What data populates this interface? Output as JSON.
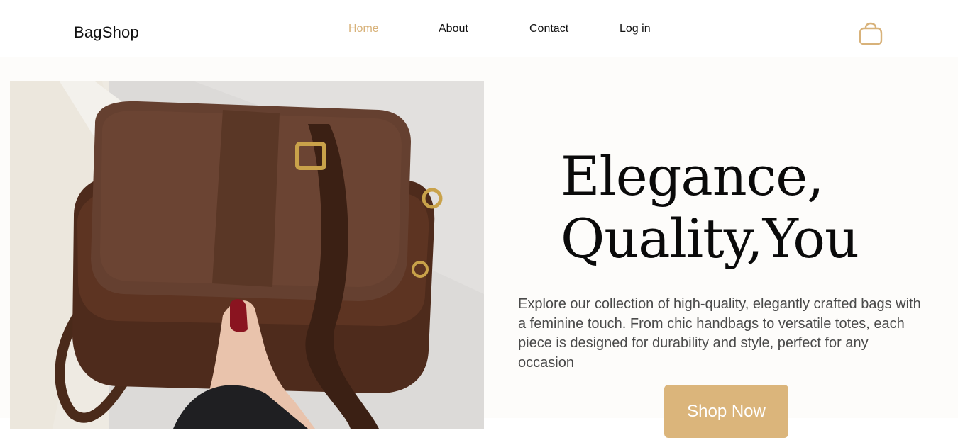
{
  "brand": {
    "name": "BagShop",
    "accent_color": "#dbb57b",
    "active_nav_color": "#d8b27a"
  },
  "nav": {
    "items": [
      {
        "label": "Home",
        "active": true
      },
      {
        "label": "About",
        "active": false
      },
      {
        "label": "Contact",
        "active": false
      },
      {
        "label": "Log in",
        "active": false
      }
    ],
    "cart_icon": "shopping-bag-icon"
  },
  "hero": {
    "headline_line1": "Elegance,",
    "headline_line2": "Quality,You",
    "description": "Explore our collection of high-quality, elegantly crafted bags with a feminine touch. From chic handbags to versatile totes, each piece is designed for durability and style, perfect for any occasion",
    "cta_label": "Shop Now"
  }
}
